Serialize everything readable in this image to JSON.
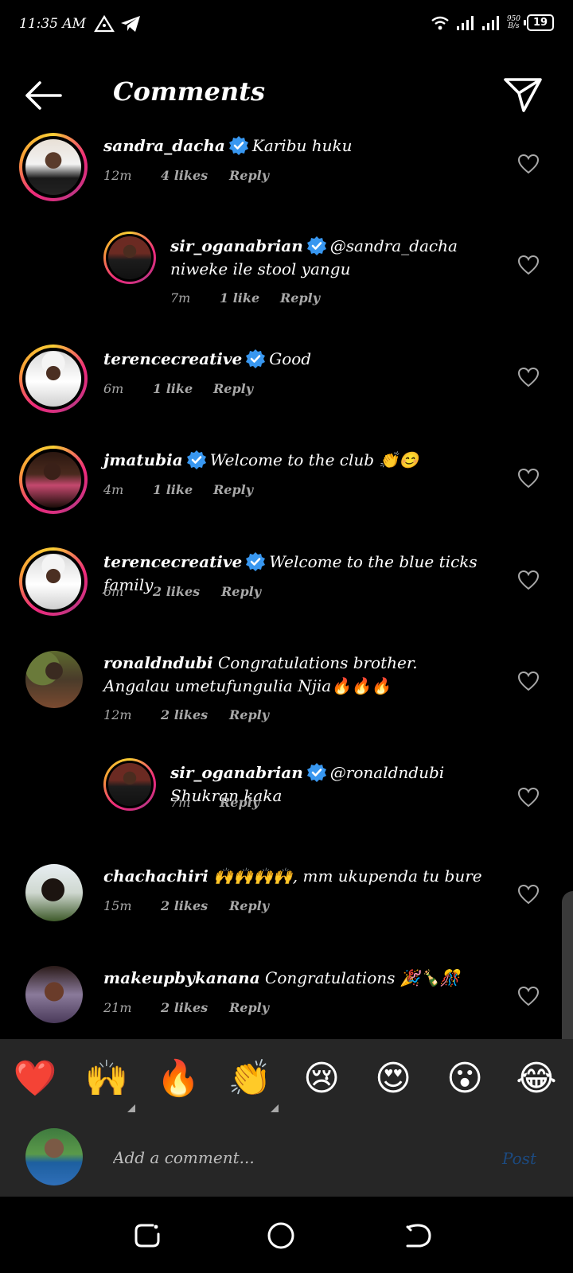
{
  "status_bar": {
    "time": "11:35 AM",
    "net_speed_value": "950",
    "net_speed_unit": "B/s",
    "battery": "19"
  },
  "header": {
    "title": "Comments",
    "back_icon": "back-arrow-icon",
    "send_icon": "paper-plane-icon"
  },
  "comments": [
    {
      "username": "sandra_dacha",
      "verified": true,
      "text": "Karibu huku",
      "time": "12m",
      "likes": "4 likes",
      "reply": "Reply"
    },
    {
      "username": "sir_oganabrian",
      "verified": true,
      "text": "@sandra_dacha niweke ile stool yangu",
      "time": "7m",
      "likes": "1 like",
      "reply": "Reply"
    },
    {
      "username": "terencecreative",
      "verified": true,
      "text": "Good",
      "time": "6m",
      "likes": "1 like",
      "reply": "Reply"
    },
    {
      "username": "jmatubia",
      "verified": true,
      "text": "Welcome to the club 👏😊",
      "time": "4m",
      "likes": "1 like",
      "reply": "Reply"
    },
    {
      "username": "terencecreative",
      "verified": true,
      "text": "Welcome to the blue ticks family",
      "time": "6m",
      "likes": "2 likes",
      "reply": "Reply"
    },
    {
      "username": "ronaldndubi",
      "verified": false,
      "text": "Congratulations brother. Angalau umetufungulia Njia🔥🔥🔥",
      "time": "12m",
      "likes": "2 likes",
      "reply": "Reply"
    },
    {
      "username": "sir_oganabrian",
      "verified": true,
      "text": "@ronaldndubi Shukran kaka",
      "time": "7m",
      "likes": "",
      "reply": "Reply"
    },
    {
      "username": "chachachiri",
      "verified": false,
      "text": "🙌🙌🙌🙌, mm ukupenda tu bure",
      "time": "15m",
      "likes": "2 likes",
      "reply": "Reply"
    },
    {
      "username": "makeupbykanana",
      "verified": false,
      "text": "Congratulations 🎉🍾🎊",
      "time": "21m",
      "likes": "2 likes",
      "reply": "Reply"
    }
  ],
  "emoji_bar": {
    "emojis": [
      "❤️",
      "🙌",
      "🔥",
      "👏",
      "😢",
      "😍",
      "😮",
      "😂"
    ]
  },
  "composer": {
    "placeholder": "Add a comment...",
    "post_label": "Post"
  },
  "colors": {
    "background": "#000000",
    "panel": "#262626",
    "meta_text": "#a8a8a8",
    "verified_blue": "#3897f0",
    "post_disabled": "#1c4a80"
  }
}
